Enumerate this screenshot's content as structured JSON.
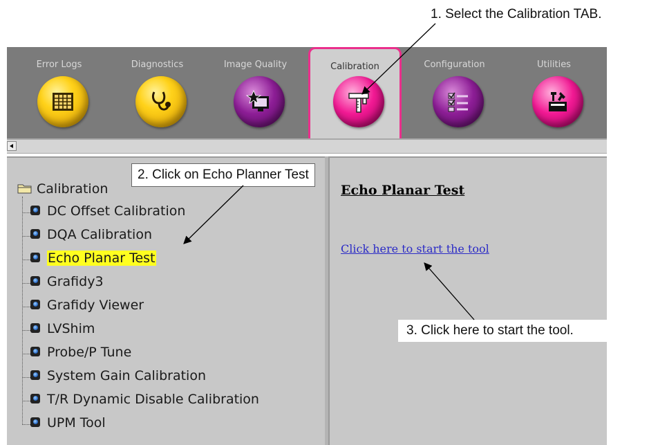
{
  "tabs": [
    {
      "label": "Error Logs",
      "icon": "error-log-grid-icon",
      "color": "yellow"
    },
    {
      "label": "Diagnostics",
      "icon": "stethoscope-icon",
      "color": "yellow"
    },
    {
      "label": "Image Quality",
      "icon": "star-monitor-icon",
      "color": "purple"
    },
    {
      "label": "Calibration",
      "icon": "caliper-icon",
      "color": "pink",
      "active": true
    },
    {
      "label": "Configuration",
      "icon": "checklist-icon",
      "color": "purple"
    },
    {
      "label": "Utilities",
      "icon": "toolbox-icon",
      "color": "pink"
    }
  ],
  "tree": {
    "root": "Calibration",
    "items": [
      "DC Offset Calibration",
      "DQA Calibration",
      "Echo Planar Test",
      "Grafidy3",
      "Grafidy Viewer",
      "LVShim",
      "Probe/P Tune",
      "System Gain Calibration",
      "T/R Dynamic Disable Calibration",
      "UPM Tool"
    ],
    "selected": "Echo Planar Test"
  },
  "content": {
    "title": "Echo Planar Test",
    "link": "Click here to start the tool"
  },
  "callouts": {
    "step1": "1. Select the Calibration TAB.",
    "step2": "2. Click on Echo Planner Test",
    "step3": "3. Click here to start the tool."
  },
  "colors": {
    "tabbar_bg": "#7b7b7b",
    "active_tab_border": "#ea2f8c",
    "panel_bg": "#c8c8c8",
    "selection_highlight": "#ffff20",
    "link": "#2b2bc6"
  }
}
